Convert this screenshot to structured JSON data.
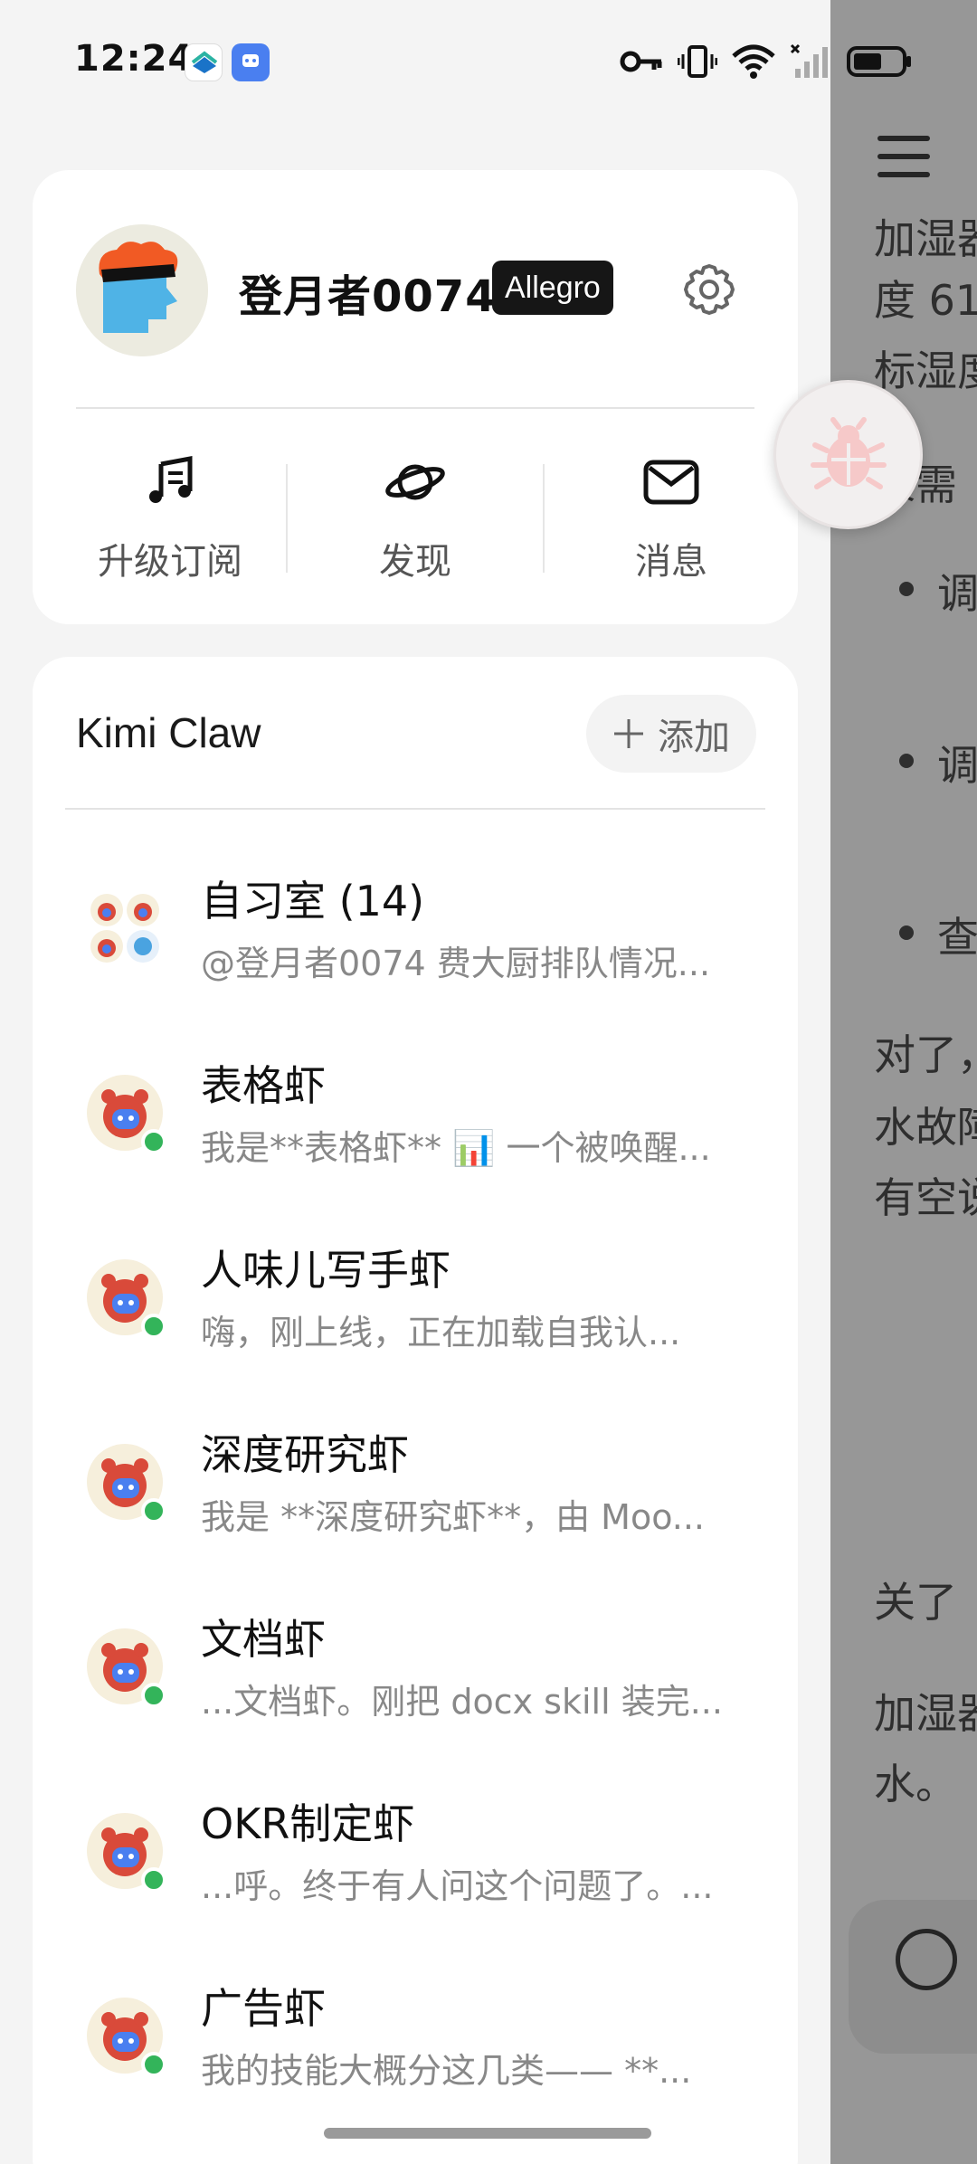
{
  "status_bar": {
    "time": "12:24"
  },
  "profile": {
    "username": "登月者0074",
    "plan_badge": "Allegro",
    "settings_icon": "gear-icon"
  },
  "quick_actions": [
    {
      "label": "升级订阅",
      "icon": "music-note-icon"
    },
    {
      "label": "发现",
      "icon": "planet-icon"
    },
    {
      "label": "消息",
      "icon": "mail-icon"
    }
  ],
  "claw": {
    "title": "Kimi Claw",
    "add_label": "添加"
  },
  "chats": [
    {
      "name": "自习室 (14)",
      "preview": "@登月者0074 费大厨排队情况...",
      "group": true
    },
    {
      "name": "表格虾",
      "preview": "我是**表格虾** 📊 一个被唤醒..."
    },
    {
      "name": "人味儿写手虾",
      "preview": "嗨，刚上线，正在加载自我认..."
    },
    {
      "name": "深度研究虾",
      "preview": "我是 **深度研究虾**，由 Moo..."
    },
    {
      "name": "文档虾",
      "preview": "...文档虾。刚把 docx skill 装完..."
    },
    {
      "name": "OKR制定虾",
      "preview": "...呼。终于有人问这个问题了。..."
    },
    {
      "name": "广告虾",
      "preview": "我的技能大概分这几类—— **..."
    }
  ],
  "background_page": {
    "lines": [
      "加湿器",
      "度 61",
      "标湿度",
      "果需",
      "调",
      "调",
      "查",
      "对了，",
      "水故障",
      "有空说",
      "关了",
      "加湿器",
      "水。"
    ]
  },
  "colors": {
    "online": "#33b45a",
    "badge_bg": "#161616",
    "overlay": "rgba(40,40,40,0.47)"
  }
}
